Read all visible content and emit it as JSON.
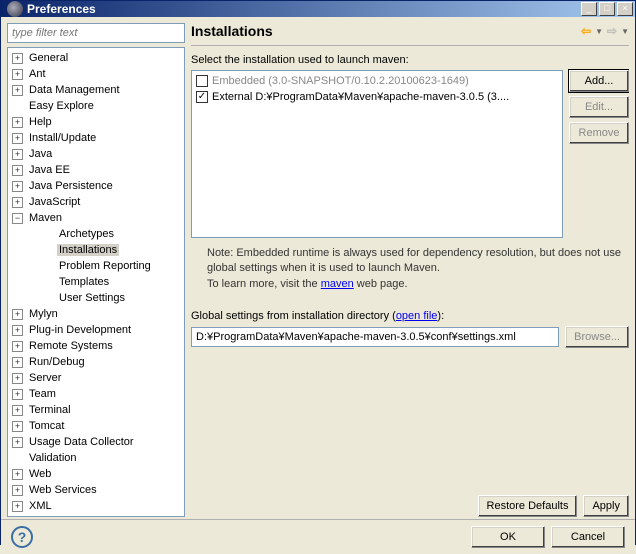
{
  "window": {
    "title": "Preferences"
  },
  "filter": {
    "placeholder": "type filter text"
  },
  "tree": [
    {
      "label": "General",
      "toggle": "+",
      "level": 1
    },
    {
      "label": "Ant",
      "toggle": "+",
      "level": 1
    },
    {
      "label": "Data Management",
      "toggle": "+",
      "level": 1
    },
    {
      "label": "Easy Explore",
      "toggle": "",
      "level": 1
    },
    {
      "label": "Help",
      "toggle": "+",
      "level": 1
    },
    {
      "label": "Install/Update",
      "toggle": "+",
      "level": 1
    },
    {
      "label": "Java",
      "toggle": "+",
      "level": 1
    },
    {
      "label": "Java EE",
      "toggle": "+",
      "level": 1
    },
    {
      "label": "Java Persistence",
      "toggle": "+",
      "level": 1
    },
    {
      "label": "JavaScript",
      "toggle": "+",
      "level": 1
    },
    {
      "label": "Maven",
      "toggle": "−",
      "level": 1
    },
    {
      "label": "Archetypes",
      "toggle": "",
      "level": 2
    },
    {
      "label": "Installations",
      "toggle": "",
      "level": 2,
      "selected": true
    },
    {
      "label": "Problem Reporting",
      "toggle": "",
      "level": 2
    },
    {
      "label": "Templates",
      "toggle": "",
      "level": 2
    },
    {
      "label": "User Settings",
      "toggle": "",
      "level": 2
    },
    {
      "label": "Mylyn",
      "toggle": "+",
      "level": 1
    },
    {
      "label": "Plug-in Development",
      "toggle": "+",
      "level": 1
    },
    {
      "label": "Remote Systems",
      "toggle": "+",
      "level": 1
    },
    {
      "label": "Run/Debug",
      "toggle": "+",
      "level": 1
    },
    {
      "label": "Server",
      "toggle": "+",
      "level": 1
    },
    {
      "label": "Team",
      "toggle": "+",
      "level": 1
    },
    {
      "label": "Terminal",
      "toggle": "+",
      "level": 1
    },
    {
      "label": "Tomcat",
      "toggle": "+",
      "level": 1
    },
    {
      "label": "Usage Data Collector",
      "toggle": "+",
      "level": 1
    },
    {
      "label": "Validation",
      "toggle": "",
      "level": 1
    },
    {
      "label": "Web",
      "toggle": "+",
      "level": 1
    },
    {
      "label": "Web Services",
      "toggle": "+",
      "level": 1
    },
    {
      "label": "XML",
      "toggle": "+",
      "level": 1
    }
  ],
  "page": {
    "title": "Installations",
    "select_label": "Select the installation used to launch maven:",
    "installs": [
      {
        "checked": false,
        "label": "Embedded (3.0-SNAPSHOT/0.10.2.20100623-1649)"
      },
      {
        "checked": true,
        "label": "External D:¥ProgramData¥Maven¥apache-maven-3.0.5 (3...."
      }
    ],
    "buttons": {
      "add": "Add...",
      "edit": "Edit...",
      "remove": "Remove"
    },
    "note1": "Note: Embedded runtime is always used for dependency resolution, but does not use global settings when it is used to launch Maven.",
    "note2a": "To learn more, visit the ",
    "note2link": "maven",
    "note2b": " web page.",
    "global_label_a": "Global settings from installation directory (",
    "global_link": "open file",
    "global_label_b": "):",
    "global_value": "D:¥ProgramData¥Maven¥apache-maven-3.0.5¥conf¥settings.xml",
    "browse": "Browse...",
    "restore": "Restore Defaults",
    "apply": "Apply"
  },
  "footer": {
    "ok": "OK",
    "cancel": "Cancel"
  }
}
